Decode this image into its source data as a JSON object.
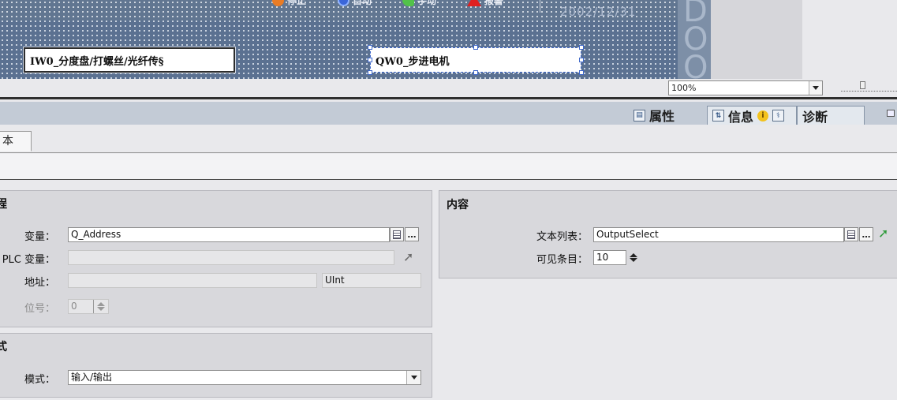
{
  "canvas": {
    "buttons": {
      "stop": "停止",
      "auto": "自动",
      "manual": "手动",
      "alarm": "报警"
    },
    "date": "2002/12/31",
    "side_text": "DOO",
    "dropdown_left": "IW0_分度盘/打螺丝/光纤传§",
    "dropdown_right": "QW0_步进电机"
  },
  "zoom": {
    "value": "100%"
  },
  "inspector": {
    "tabs": {
      "properties": "属性",
      "info": "信息",
      "diagnostics": "诊断"
    },
    "subtab": "本",
    "process": {
      "title": "程",
      "variable_label": "变量：",
      "variable_value": "Q_Address",
      "plc_variable_label": "PLC 变量：",
      "address_label": "地址：",
      "address_type": "UInt",
      "bit_label": "位号：",
      "bit_value": "0"
    },
    "mode": {
      "title": "式",
      "mode_label": "模式：",
      "mode_value": "输入/输出"
    },
    "content": {
      "title": "内容",
      "textlist_label": "文本列表：",
      "textlist_value": "OutputSelect",
      "visible_items_label": "可见条目：",
      "visible_items_value": "10"
    }
  },
  "colors": {
    "canvas": "#5b7191",
    "goto_arrow_enabled": "#2e9b3a",
    "goto_arrow_disabled": "#6a6a6a",
    "selection": "#3e67c9"
  }
}
